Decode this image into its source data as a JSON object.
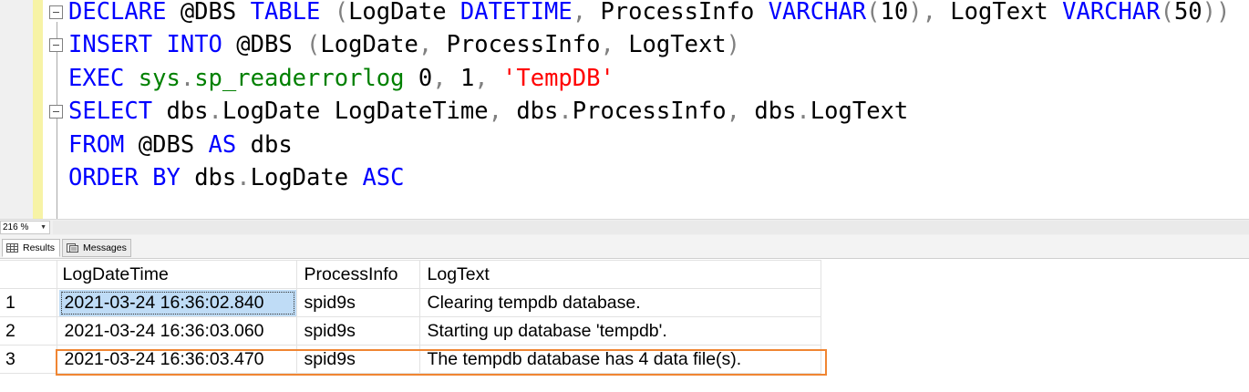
{
  "editor": {
    "lines": [
      {
        "tokens": [
          {
            "t": "DECLARE",
            "c": "kw"
          },
          {
            "t": " @DBS ",
            "c": ""
          },
          {
            "t": "TABLE",
            "c": "kw"
          },
          {
            "t": " (",
            "c": "gray"
          },
          {
            "t": "LogDate ",
            "c": ""
          },
          {
            "t": "DATETIME",
            "c": "kw"
          },
          {
            "t": ", ",
            "c": "gray"
          },
          {
            "t": "ProcessInfo ",
            "c": ""
          },
          {
            "t": "VARCHAR",
            "c": "kw"
          },
          {
            "t": "(",
            "c": "gray"
          },
          {
            "t": "10",
            "c": ""
          },
          {
            "t": "), ",
            "c": "gray"
          },
          {
            "t": "LogText ",
            "c": ""
          },
          {
            "t": "VARCHAR",
            "c": "kw"
          },
          {
            "t": "(",
            "c": "gray"
          },
          {
            "t": "50",
            "c": ""
          },
          {
            "t": "))",
            "c": "gray"
          }
        ]
      },
      {
        "tokens": [
          {
            "t": "INSERT",
            "c": "kw"
          },
          {
            "t": " ",
            "c": ""
          },
          {
            "t": "INTO",
            "c": "kw"
          },
          {
            "t": " @DBS ",
            "c": ""
          },
          {
            "t": "(",
            "c": "gray"
          },
          {
            "t": "LogDate",
            "c": ""
          },
          {
            "t": ", ",
            "c": "gray"
          },
          {
            "t": "ProcessInfo",
            "c": ""
          },
          {
            "t": ", ",
            "c": "gray"
          },
          {
            "t": "LogText",
            "c": ""
          },
          {
            "t": ")",
            "c": "gray"
          }
        ]
      },
      {
        "tokens": [
          {
            "t": "EXEC",
            "c": "kw"
          },
          {
            "t": " ",
            "c": ""
          },
          {
            "t": "sys",
            "c": "sys"
          },
          {
            "t": ".",
            "c": "gray"
          },
          {
            "t": "sp_readerrorlog",
            "c": "sys"
          },
          {
            "t": " 0",
            "c": ""
          },
          {
            "t": ", ",
            "c": "gray"
          },
          {
            "t": "1",
            "c": ""
          },
          {
            "t": ", ",
            "c": "gray"
          },
          {
            "t": "'TempDB'",
            "c": "str"
          }
        ]
      },
      {
        "tokens": [
          {
            "t": "SELECT",
            "c": "kw"
          },
          {
            "t": " dbs",
            "c": ""
          },
          {
            "t": ".",
            "c": "gray"
          },
          {
            "t": "LogDate LogDateTime",
            "c": ""
          },
          {
            "t": ", ",
            "c": "gray"
          },
          {
            "t": "dbs",
            "c": ""
          },
          {
            "t": ".",
            "c": "gray"
          },
          {
            "t": "ProcessInfo",
            "c": ""
          },
          {
            "t": ", ",
            "c": "gray"
          },
          {
            "t": "dbs",
            "c": ""
          },
          {
            "t": ".",
            "c": "gray"
          },
          {
            "t": "LogText",
            "c": ""
          }
        ]
      },
      {
        "tokens": [
          {
            "t": "FROM",
            "c": "kw"
          },
          {
            "t": " @DBS ",
            "c": ""
          },
          {
            "t": "AS",
            "c": "kw"
          },
          {
            "t": " dbs",
            "c": ""
          }
        ]
      },
      {
        "tokens": [
          {
            "t": "ORDER",
            "c": "kw"
          },
          {
            "t": " ",
            "c": ""
          },
          {
            "t": "BY",
            "c": "kw"
          },
          {
            "t": " dbs",
            "c": ""
          },
          {
            "t": ".",
            "c": "gray"
          },
          {
            "t": "LogDate ",
            "c": ""
          },
          {
            "t": "ASC",
            "c": "kw"
          }
        ]
      }
    ],
    "colors": {
      "keyword": "#0000ff",
      "system": "#008000",
      "string": "#ff0000",
      "operator": "#808080"
    }
  },
  "zoom": {
    "value": "216 %"
  },
  "tabs": {
    "results": "Results",
    "messages": "Messages"
  },
  "grid": {
    "columns": [
      "LogDateTime",
      "ProcessInfo",
      "LogText"
    ],
    "rows": [
      {
        "num": "1",
        "date": "2021-03-24 16:36:02.840",
        "proc": "spid9s",
        "text": "Clearing tempdb database."
      },
      {
        "num": "2",
        "date": "2021-03-24 16:36:03.060",
        "proc": "spid9s",
        "text": "Starting up database 'tempdb'."
      },
      {
        "num": "3",
        "date": "2021-03-24 16:36:03.470",
        "proc": "spid9s",
        "text": "The tempdb database has 4 data file(s)."
      }
    ],
    "highlight_color": "#f08532",
    "selection_color": "#bfdcf6"
  }
}
